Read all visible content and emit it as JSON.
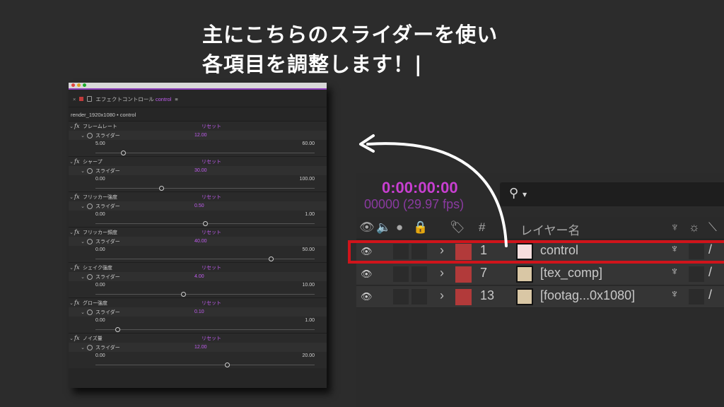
{
  "caption": {
    "line1": "主にこちらのスライダーを使い",
    "line2": "各項目を調整します！|"
  },
  "panel": {
    "tab_title": "エフェクトコントロール",
    "tab_target": "control",
    "menu_glyph": "≡",
    "path": "render_1920x1080 • control",
    "reset_label": "リセット",
    "param_label": "スライダー",
    "effects": [
      {
        "name": "フレームレート",
        "value": "12.00",
        "min": "5.00",
        "max": "60.00",
        "pos": 0.127
      },
      {
        "name": "シャープ",
        "value": "30.00",
        "min": "0.00",
        "max": "100.00",
        "pos": 0.3
      },
      {
        "name": "フリッカー強度",
        "value": "0.50",
        "min": "0.00",
        "max": "1.00",
        "pos": 0.5
      },
      {
        "name": "フリッカー頻度",
        "value": "40.00",
        "min": "0.00",
        "max": "50.00",
        "pos": 0.8
      },
      {
        "name": "シェイク強度",
        "value": "4.00",
        "min": "0.00",
        "max": "10.00",
        "pos": 0.4
      },
      {
        "name": "グロー強度",
        "value": "0.10",
        "min": "0.00",
        "max": "1.00",
        "pos": 0.1
      },
      {
        "name": "ノイズ量",
        "value": "12.00",
        "min": "0.00",
        "max": "20.00",
        "pos": 0.6
      }
    ]
  },
  "timeline": {
    "timecode": "0:00:00:00",
    "frames": "00000 (29.97 fps)",
    "search_icon": "search-icon",
    "header": {
      "hash": "#",
      "layer_name": "レイヤー名"
    },
    "layers": [
      {
        "num": "1",
        "name": "control",
        "thumb": "solid",
        "selected": true
      },
      {
        "num": "7",
        "name": "[tex_comp]",
        "thumb": "comp",
        "selected": false
      },
      {
        "num": "13",
        "name": "[footag...0x1080]",
        "thumb": "comp",
        "selected": false
      }
    ]
  },
  "colors": {
    "accent": "#c15cf0",
    "timecode": "#c83fd1",
    "highlight": "#d0141b",
    "label_red": "#b23a3a"
  }
}
